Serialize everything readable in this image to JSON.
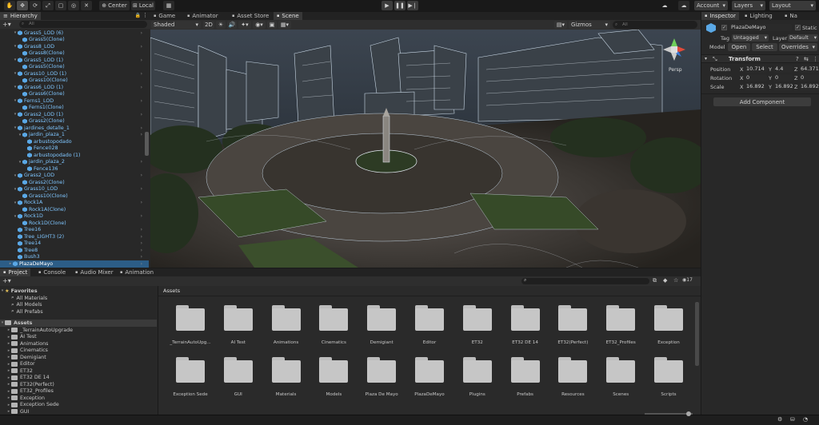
{
  "toolbar": {
    "center_label": "Center",
    "local_label": "Local",
    "account_label": "Account",
    "layers_label": "Layers",
    "layout_label": "Layout"
  },
  "hierarchy": {
    "title": "Hierarchy",
    "search_placeholder": "All",
    "items": [
      {
        "label": "Grass5_LOD (6)",
        "depth": 1,
        "expanded": true,
        "icon": "prefab"
      },
      {
        "label": "Grass5(Clone)",
        "depth": 2,
        "expanded": null,
        "icon": "prefab"
      },
      {
        "label": "Grass8_LOD",
        "depth": 1,
        "expanded": true,
        "icon": "prefab"
      },
      {
        "label": "Grass8(Clone)",
        "depth": 2,
        "expanded": null,
        "icon": "prefab"
      },
      {
        "label": "Grass5_LOD (1)",
        "depth": 1,
        "expanded": true,
        "icon": "prefab"
      },
      {
        "label": "Grass5(Clone)",
        "depth": 2,
        "expanded": null,
        "icon": "prefab"
      },
      {
        "label": "Grass10_LOD (1)",
        "depth": 1,
        "expanded": true,
        "icon": "prefab"
      },
      {
        "label": "Grass10(Clone)",
        "depth": 2,
        "expanded": null,
        "icon": "prefab"
      },
      {
        "label": "Grass6_LOD (1)",
        "depth": 1,
        "expanded": true,
        "icon": "prefab"
      },
      {
        "label": "Grass6(Clone)",
        "depth": 2,
        "expanded": null,
        "icon": "prefab"
      },
      {
        "label": "Ferns1_LOD",
        "depth": 1,
        "expanded": true,
        "icon": "prefab"
      },
      {
        "label": "Ferns1(Clone)",
        "depth": 2,
        "expanded": null,
        "icon": "prefab"
      },
      {
        "label": "Grass2_LOD (1)",
        "depth": 1,
        "expanded": true,
        "icon": "prefab"
      },
      {
        "label": "Grass2(Clone)",
        "depth": 2,
        "expanded": null,
        "icon": "prefab"
      },
      {
        "label": "jardines_detalle_1",
        "depth": 1,
        "expanded": true,
        "icon": "prefab"
      },
      {
        "label": "jardin_plaza_1",
        "depth": 2,
        "expanded": true,
        "icon": "prefab"
      },
      {
        "label": "arbustopodado",
        "depth": 3,
        "expanded": null,
        "icon": "prefab"
      },
      {
        "label": "Fence028",
        "depth": 3,
        "expanded": null,
        "icon": "prefab"
      },
      {
        "label": "arbustopodado (1)",
        "depth": 3,
        "expanded": null,
        "icon": "prefab"
      },
      {
        "label": "jardin_plaza_2",
        "depth": 2,
        "expanded": true,
        "icon": "prefab"
      },
      {
        "label": "Fence136",
        "depth": 3,
        "expanded": null,
        "icon": "prefab"
      },
      {
        "label": "Grass2_LOD",
        "depth": 1,
        "expanded": true,
        "icon": "prefab"
      },
      {
        "label": "Grass2(Clone)",
        "depth": 2,
        "expanded": null,
        "icon": "prefab"
      },
      {
        "label": "Grass10_LOD",
        "depth": 1,
        "expanded": true,
        "icon": "prefab"
      },
      {
        "label": "Grass10(Clone)",
        "depth": 2,
        "expanded": null,
        "icon": "prefab"
      },
      {
        "label": "Rock1A",
        "depth": 1,
        "expanded": true,
        "icon": "prefab"
      },
      {
        "label": "Rock1A(Clone)",
        "depth": 2,
        "expanded": null,
        "icon": "prefab"
      },
      {
        "label": "Rock1D",
        "depth": 1,
        "expanded": true,
        "icon": "prefab"
      },
      {
        "label": "Rock1D(Clone)",
        "depth": 2,
        "expanded": null,
        "icon": "prefab"
      },
      {
        "label": "Tree16",
        "depth": 1,
        "expanded": null,
        "icon": "prefab"
      },
      {
        "label": "Tree_LIGHT3 (2)",
        "depth": 1,
        "expanded": null,
        "icon": "prefab"
      },
      {
        "label": "Tree14",
        "depth": 1,
        "expanded": null,
        "icon": "prefab"
      },
      {
        "label": "Tree8",
        "depth": 1,
        "expanded": null,
        "icon": "prefab"
      },
      {
        "label": "Bush3",
        "depth": 1,
        "expanded": null,
        "icon": "prefab"
      },
      {
        "label": "PlazaDeMayo",
        "depth": 0,
        "expanded": false,
        "icon": "prefab",
        "selected": true
      }
    ]
  },
  "scene_tabs": [
    {
      "label": "Game",
      "icon": "gamepad-icon",
      "active": false
    },
    {
      "label": "Animator",
      "icon": "animator-icon",
      "active": false
    },
    {
      "label": "Asset Store",
      "icon": "store-icon",
      "active": false
    },
    {
      "label": "Scene",
      "icon": "scene-icon",
      "active": true
    }
  ],
  "scene_toolbar": {
    "shading_mode": "Shaded",
    "mode_2d": "2D",
    "gizmos_label": "Gizmos",
    "search_placeholder": "All"
  },
  "scene_view": {
    "orientation_label": "Persp"
  },
  "inspector": {
    "tabs": [
      {
        "label": "Inspector",
        "active": true
      },
      {
        "label": "Lighting",
        "active": false
      },
      {
        "label": "Na",
        "active": false
      }
    ],
    "object_name": "PlazaDeMayo",
    "static_label": "Static",
    "tag_label": "Tag",
    "tag_value": "Untagged",
    "layer_label": "Layer",
    "layer_value": "Default",
    "model_label": "Model",
    "open_label": "Open",
    "select_label": "Select",
    "overrides_label": "Overrides",
    "transform_title": "Transform",
    "position": {
      "label": "Position",
      "x": "10.714",
      "y": "4.4",
      "z": "64.371"
    },
    "rotation": {
      "label": "Rotation",
      "x": "0",
      "y": "0",
      "z": "0"
    },
    "scale": {
      "label": "Scale",
      "x": "16.892",
      "y": "16.892",
      "z": "16.892"
    },
    "add_component_label": "Add Component"
  },
  "bottom_tabs": [
    {
      "label": "Project",
      "active": true
    },
    {
      "label": "Console",
      "active": false
    },
    {
      "label": "Audio Mixer",
      "active": false
    },
    {
      "label": "Animation",
      "active": false
    }
  ],
  "project": {
    "favorites_label": "Favorites",
    "favorites": [
      "All Materials",
      "All Models",
      "All Prefabs"
    ],
    "assets_label": "Assets",
    "tree": [
      "_TerrainAutoUpgrade",
      "AI Test",
      "Animations",
      "Cinematics",
      "Demigiant",
      "Editor",
      "ET32",
      "ET32 DE 14",
      "ET32(Perfect)",
      "ET32_Profiles",
      "Exception",
      "Exception Sede",
      "GUI"
    ],
    "breadcrumb": "Assets",
    "hidden_count": "17",
    "grid_row1": [
      "_TerrainAutoUpg...",
      "AI Test",
      "Animations",
      "Cinematics",
      "Demigiant",
      "Editor",
      "ET32",
      "ET32 DE 14",
      "ET32(Perfect)",
      "ET32_Profiles",
      "Exception"
    ],
    "grid_row2": [
      "Exception Sede",
      "GUI",
      "Materials",
      "Models",
      "Plaza De Mayo",
      "PlazaDeMayo",
      "Plugins",
      "Prefabs",
      "Resources",
      "Scenes",
      "Scripts"
    ]
  },
  "colors": {
    "accent": "#2c5d87",
    "prefab_blue": "#7fc6ff",
    "panel": "#282828",
    "toolbar": "#191919"
  }
}
